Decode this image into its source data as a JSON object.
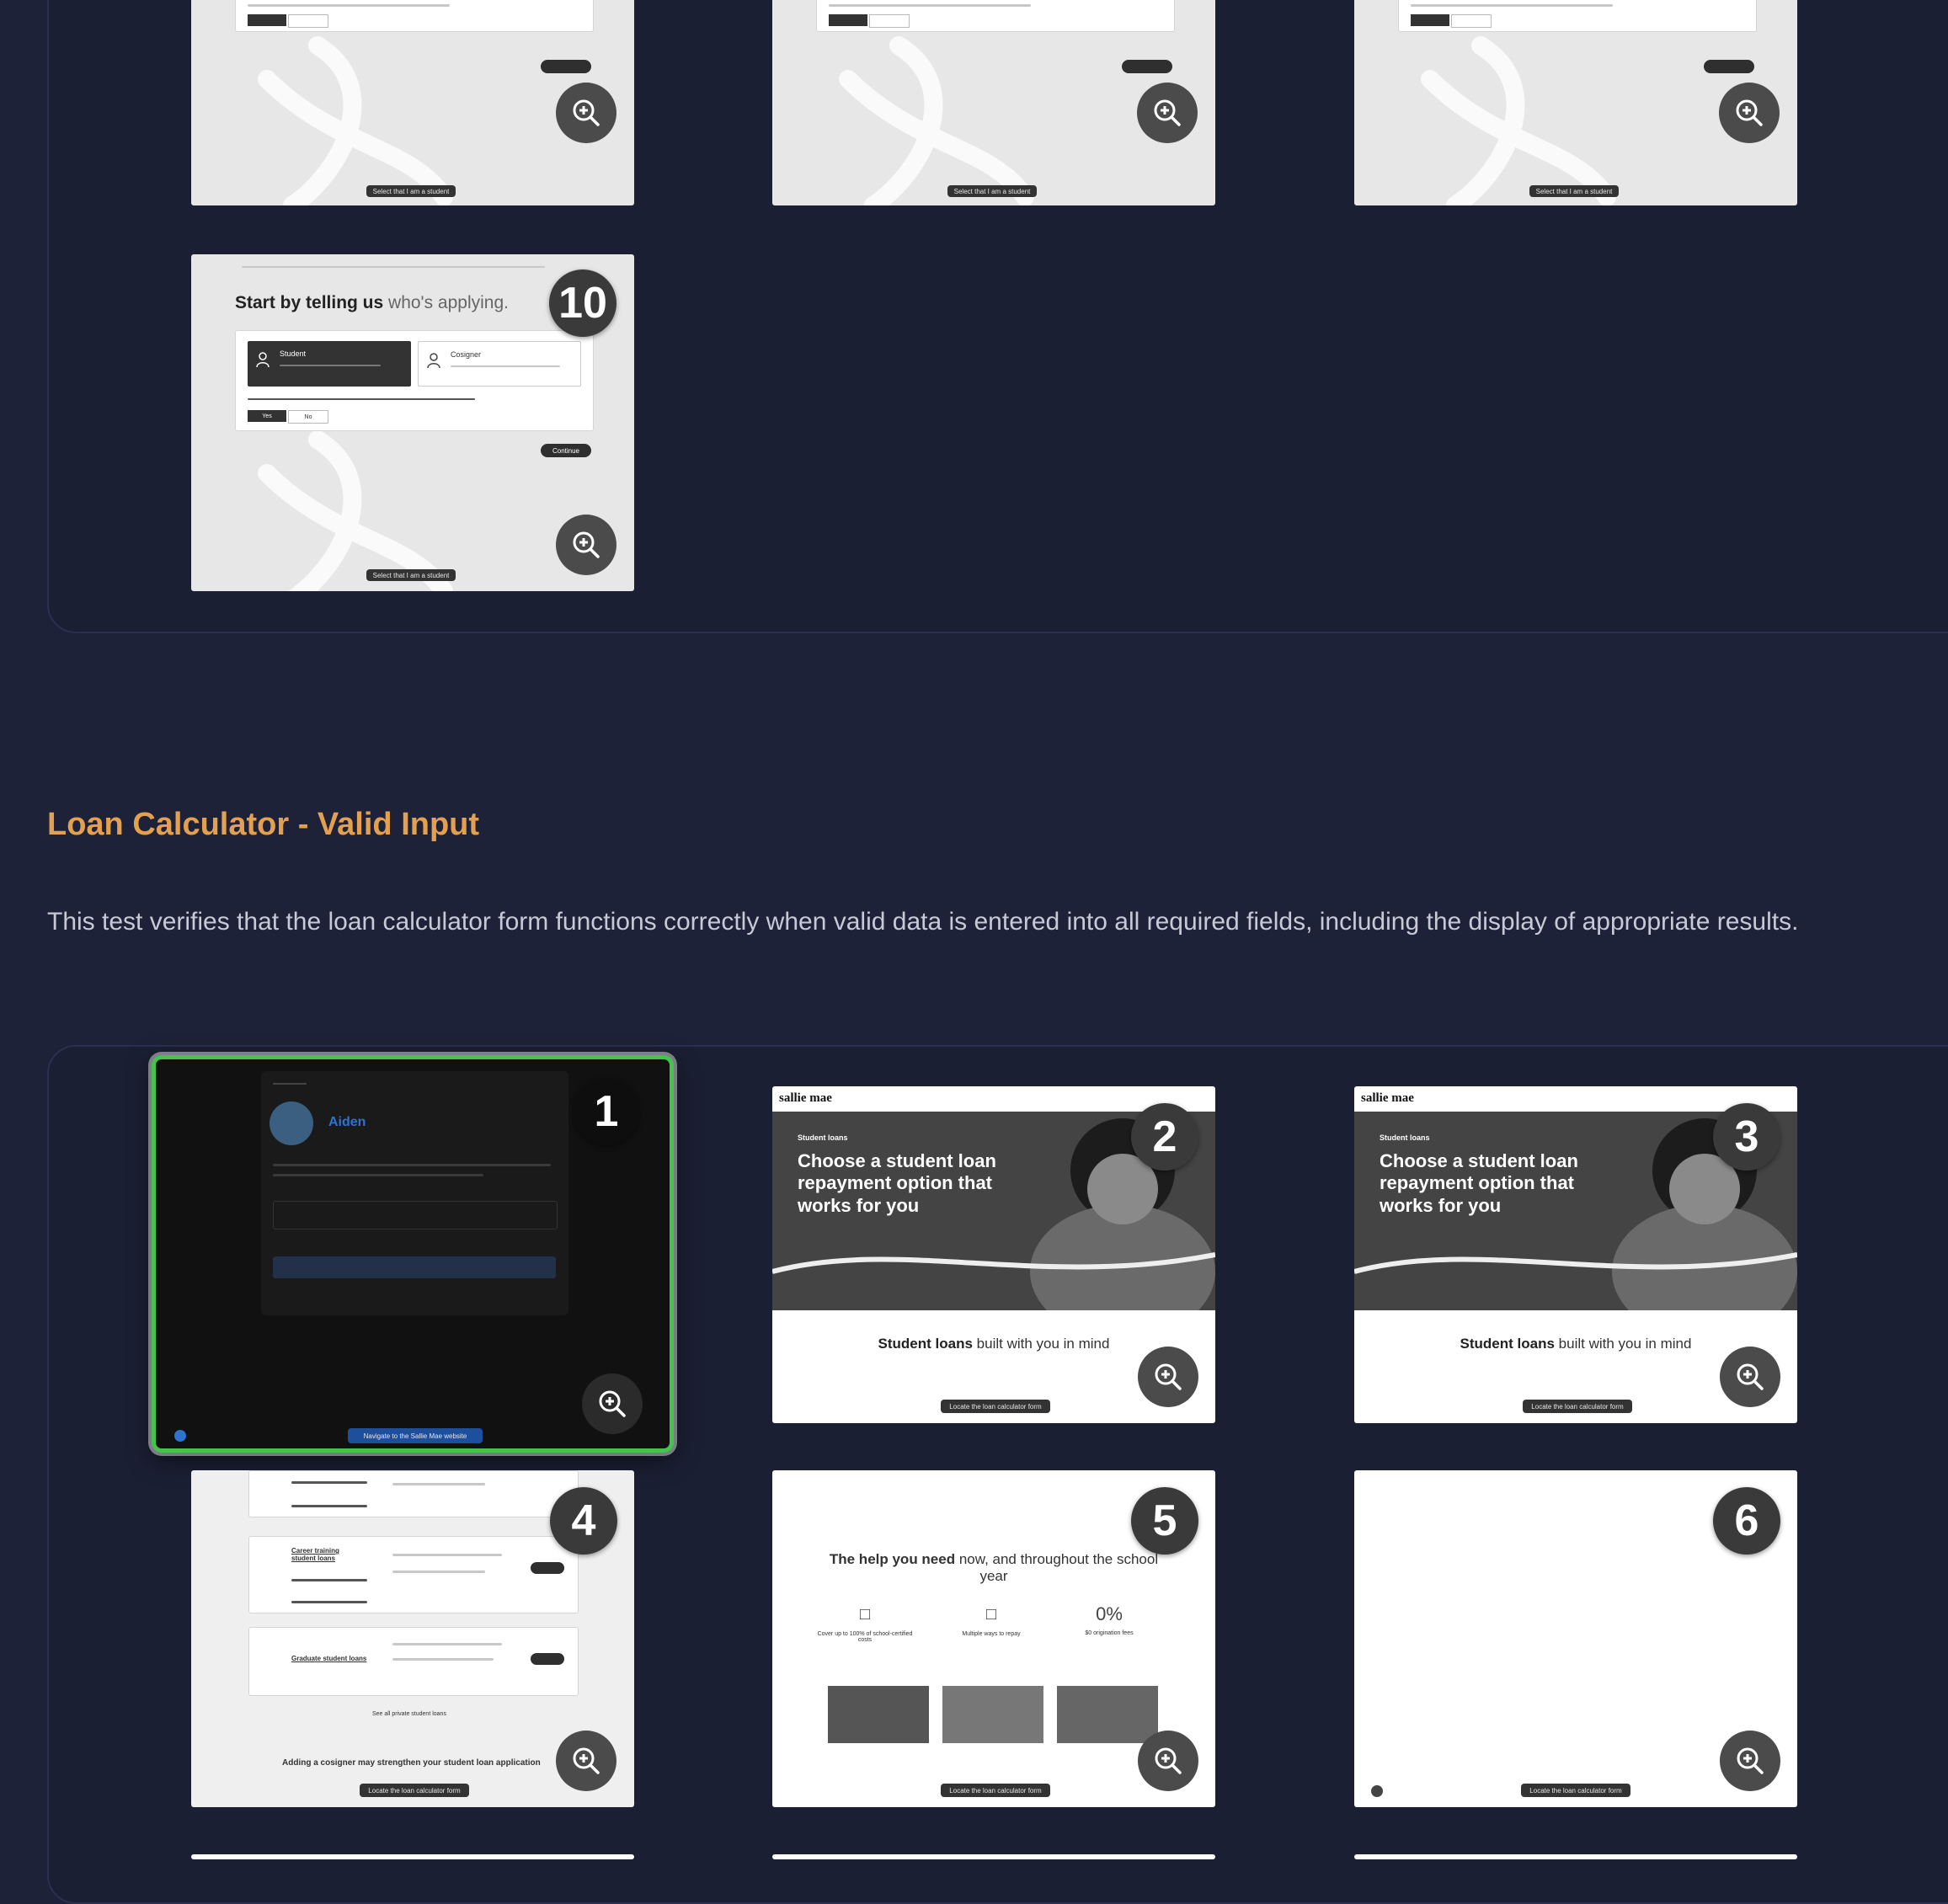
{
  "top_group": {
    "tiles": [
      {
        "footer_label": "Select that I am a student"
      },
      {
        "footer_label": "Select that I am a student"
      },
      {
        "footer_label": "Select that I am a student"
      },
      {
        "badge": "10",
        "heading_bold": "Start by telling us",
        "heading_rest": " who's applying.",
        "option_student": "Student",
        "option_cosigner": "Cosigner",
        "yes": "Yes",
        "no": "No",
        "continue": "Continue",
        "footer_label": "Select that I am a student"
      }
    ]
  },
  "section": {
    "title": "Loan Calculator - Valid Input",
    "description": "This test verifies that the loan calculator form functions correctly when valid data is entered into all required fields, including the display of appropriate results."
  },
  "bottom_group": {
    "tiles": [
      {
        "badge": "1",
        "agent_name": "Aiden",
        "footer_label": "Navigate to the Sallie Mae website"
      },
      {
        "badge": "2",
        "brand": "sallie mae",
        "kicker": "Student loans",
        "hero_title": "Choose a student loan repayment option that works for you",
        "sub_bold": "Student loans",
        "sub_rest": " built with you in mind",
        "footer_label": "Locate the loan calculator form"
      },
      {
        "badge": "3",
        "brand": "sallie mae",
        "kicker": "Student loans",
        "hero_title": "Choose a student loan repayment option that works for you",
        "sub_bold": "Student loans",
        "sub_rest": " built with you in mind",
        "footer_label": "Locate the loan calculator form"
      },
      {
        "badge": "4",
        "row_label_1": "Career training student loans",
        "row_label_2": "Graduate student loans",
        "see_all": "See all private student loans",
        "cosigner_heading": "Adding a cosigner may strengthen your student loan application",
        "footer_label": "Locate the loan calculator form"
      },
      {
        "badge": "5",
        "heading_bold": "The help you need",
        "heading_rest": " now, and throughout the school year",
        "stat_1": "Cover up to 100% of school-certified costs",
        "stat_2": "Multiple ways to repay",
        "stat_3_value": "0%",
        "stat_3": "$0 origination fees",
        "footer_label": "Locate the loan calculator form"
      },
      {
        "badge": "6",
        "footer_label": "Locate the loan calculator form"
      }
    ]
  },
  "colors": {
    "background": "#1e2238",
    "panel": "#1b1f33",
    "accent_title": "#e3a050",
    "selected_border": "#46c24e"
  },
  "icons": [
    "zoom-in-icon",
    "swirl-decoration",
    "user-icon",
    "avatar"
  ]
}
